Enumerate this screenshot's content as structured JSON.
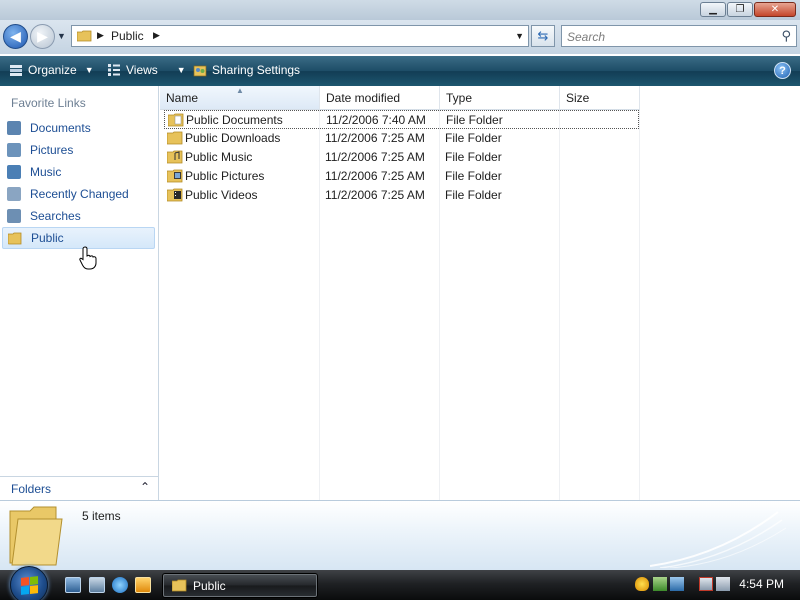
{
  "window": {
    "minimize_glyph": "▁",
    "maximize_glyph": "❐",
    "close_glyph": "✕"
  },
  "address": {
    "path_label": "Public",
    "search_placeholder": "Search"
  },
  "toolbar": {
    "organize_label": "Organize",
    "views_label": "Views",
    "sharing_label": "Sharing Settings",
    "help_glyph": "?"
  },
  "nav": {
    "favorites_title": "Favorite Links",
    "items": [
      {
        "label": "Documents",
        "icon": "documents-icon",
        "color": "#5b84b0"
      },
      {
        "label": "Pictures",
        "icon": "pictures-icon",
        "color": "#6c93bb"
      },
      {
        "label": "Music",
        "icon": "music-icon",
        "color": "#4b7fb5"
      },
      {
        "label": "Recently Changed",
        "icon": "recent-icon",
        "color": "#8aa5c2"
      },
      {
        "label": "Searches",
        "icon": "searches-icon",
        "color": "#6d8fb3"
      },
      {
        "label": "Public",
        "icon": "folder-icon",
        "color": "#e7c25a",
        "selected": true
      }
    ],
    "folders_label": "Folders"
  },
  "columns": {
    "name": "Name",
    "date": "Date modified",
    "type": "Type",
    "size": "Size"
  },
  "files": [
    {
      "name": "Public Documents",
      "date": "11/2/2006 7:40 AM",
      "type": "File Folder",
      "size": ""
    },
    {
      "name": "Public Downloads",
      "date": "11/2/2006 7:25 AM",
      "type": "File Folder",
      "size": ""
    },
    {
      "name": "Public Music",
      "date": "11/2/2006 7:25 AM",
      "type": "File Folder",
      "size": ""
    },
    {
      "name": "Public Pictures",
      "date": "11/2/2006 7:25 AM",
      "type": "File Folder",
      "size": ""
    },
    {
      "name": "Public Videos",
      "date": "11/2/2006 7:25 AM",
      "type": "File Folder",
      "size": ""
    }
  ],
  "details": {
    "item_count": "5 items"
  },
  "taskbar": {
    "window_label": "Public",
    "clock": "4:54 PM"
  },
  "colors": {
    "link_blue": "#1d4e94",
    "folder_yellow": "#e7c25a",
    "toolbar_teal": "#1d4d67"
  }
}
